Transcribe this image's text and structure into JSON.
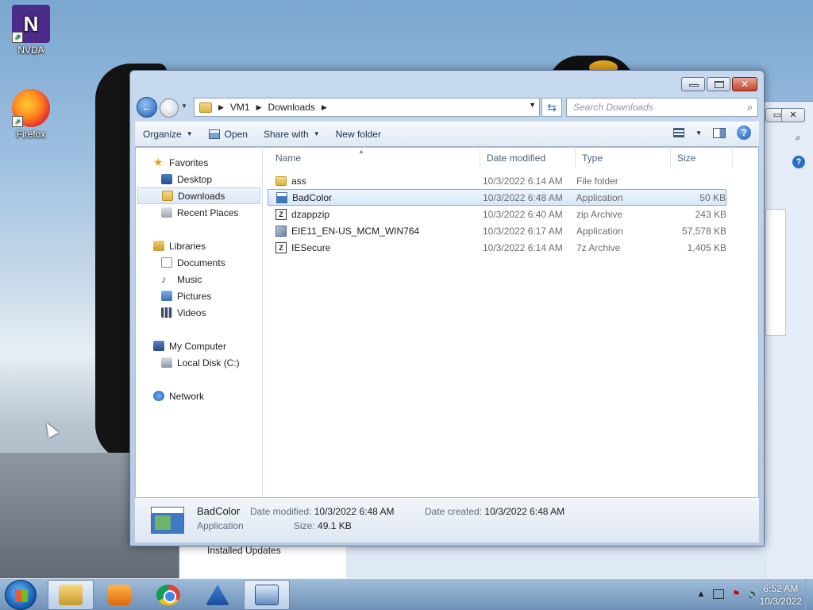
{
  "desktop": {
    "icons": [
      {
        "label": "NVDA",
        "icon": "nvda-icon"
      },
      {
        "label": "Firefox",
        "icon": "firefox-icon"
      }
    ]
  },
  "background_window": {
    "installed_updates": "Installed Updates"
  },
  "explorer": {
    "breadcrumb": [
      "VM1",
      "Downloads"
    ],
    "search_placeholder": "Search Downloads",
    "toolbar": {
      "organize": "Organize",
      "open": "Open",
      "share_with": "Share with",
      "new_folder": "New folder"
    },
    "nav": {
      "favorites": "Favorites",
      "desktop": "Desktop",
      "downloads": "Downloads",
      "recent_places": "Recent Places",
      "libraries": "Libraries",
      "documents": "Documents",
      "music": "Music",
      "pictures": "Pictures",
      "videos": "Videos",
      "my_computer": "My Computer",
      "local_disk": "Local Disk (C:)",
      "network": "Network"
    },
    "columns": {
      "name": "Name",
      "date_modified": "Date modified",
      "type": "Type",
      "size": "Size"
    },
    "files": [
      {
        "name": "ass",
        "date": "10/3/2022 6:14 AM",
        "type": "File folder",
        "size": "",
        "icon": "folder-icon"
      },
      {
        "name": "BadColor",
        "date": "10/3/2022 6:48 AM",
        "type": "Application",
        "size": "50 KB",
        "icon": "application-icon",
        "selected": true
      },
      {
        "name": "dzappzip",
        "date": "10/3/2022 6:40 AM",
        "type": "zip Archive",
        "size": "243 KB",
        "icon": "zip-archive-icon"
      },
      {
        "name": "EIE11_EN-US_MCM_WIN764",
        "date": "10/3/2022 6:17 AM",
        "type": "Application",
        "size": "57,578 KB",
        "icon": "setup-icon"
      },
      {
        "name": "IESecure",
        "date": "10/3/2022 6:14 AM",
        "type": "7z Archive",
        "size": "1,405 KB",
        "icon": "zip-archive-icon"
      }
    ],
    "details": {
      "name": "BadColor",
      "type": "Application",
      "date_modified_label": "Date modified:",
      "date_modified": "10/3/2022 6:48 AM",
      "size_label": "Size:",
      "size": "49.1 KB",
      "date_created_label": "Date created:",
      "date_created": "10/3/2022 6:48 AM"
    }
  },
  "taskbar": {
    "apps": [
      "windows-explorer-icon",
      "media-player-icon",
      "chrome-icon",
      "system-tool-icon",
      "control-panel-icon"
    ],
    "clock_time": "6:52 AM",
    "clock_date": "10/3/2022"
  }
}
